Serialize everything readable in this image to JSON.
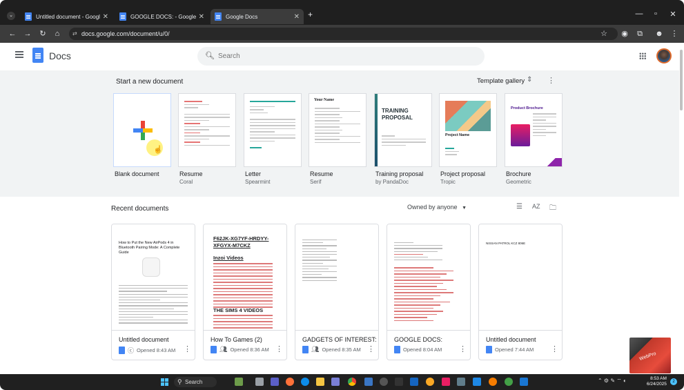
{
  "browser": {
    "tabs": [
      {
        "label": "Untitled document - Google Docs",
        "active": false
      },
      {
        "label": "GOOGLE DOCS: - Google Docs",
        "active": false
      },
      {
        "label": "Google Docs",
        "active": true
      }
    ],
    "new_tab": "+",
    "url": "docs.google.com/document/u/0/"
  },
  "header": {
    "app_name": "Docs",
    "search_placeholder": "Search"
  },
  "templates": {
    "section_label": "Start a new document",
    "gallery_label": "Template gallery",
    "items": [
      {
        "name": "Blank document",
        "sub": ""
      },
      {
        "name": "Resume",
        "sub": "Coral"
      },
      {
        "name": "Letter",
        "sub": "Spearmint"
      },
      {
        "name": "Resume",
        "sub": "Serif"
      },
      {
        "name": "Training proposal",
        "sub": "by PandaDoc"
      },
      {
        "name": "Project proposal",
        "sub": "Tropic"
      },
      {
        "name": "Brochure",
        "sub": "Geometric"
      }
    ],
    "serif_resume_name": "Your Name",
    "training_cover": "TRAINING PROPOSAL",
    "project_cover": "Project Name",
    "brochure_cover": "Product Brochure"
  },
  "recent": {
    "section_label": "Recent documents",
    "owner_filter": "Owned by anyone",
    "sort_label": "AZ",
    "docs": [
      {
        "title": "Untitled document",
        "opened": "Opened 8:43 AM",
        "shared": true,
        "preview_heading": "How to Put the New AirPods 4 in Bluetooth Pairing Mode: A Complete Guide"
      },
      {
        "title": "How To Games (2)",
        "opened": "Opened 8:36 AM",
        "shared": true,
        "preview_heading": "F62JK-XG7YF-HRDYY-XFGYX-M7CKZ",
        "preview_section1": "Inzoi Videos",
        "preview_section2": "THE SIMS 4 VIDEOS"
      },
      {
        "title": "GADGETS OF INTEREST:",
        "opened": "Opened 8:35 AM",
        "shared": true
      },
      {
        "title": "GOOGLE DOCS:",
        "opened": "Opened 8:04 AM",
        "shared": false
      },
      {
        "title": "Untitled document",
        "opened": "Opened 7:44 AM",
        "shared": false,
        "preview_heading": "NISSAN PATROL KCZ 806E"
      }
    ]
  },
  "watermark": "WebPro",
  "taskbar": {
    "search_label": "Search",
    "time": "8:53 AM",
    "date": "6/24/2025",
    "notifications": "2"
  },
  "colors": {
    "accent": "#1a73e8",
    "docs_blue": "#4285f4",
    "template_bg": "#f1f3f4"
  }
}
